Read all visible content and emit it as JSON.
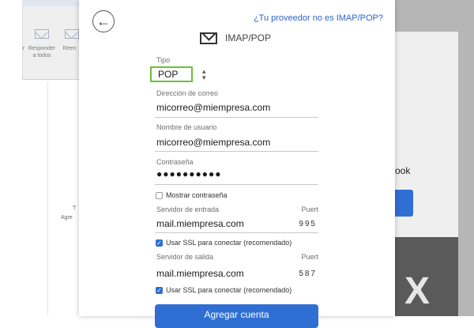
{
  "background_app": {
    "reply_all_label": "Responder\na todos",
    "forward_label": "Reen",
    "left_label": "r",
    "side_text_1": "T",
    "side_text_2": "Agre",
    "right_text": "ook",
    "colors": {
      "accent": "#2f6fd4"
    }
  },
  "dialog": {
    "provider_link": "¿Tu proveedor no es IMAP/POP?",
    "title": "IMAP/POP",
    "type_label": "Tipo",
    "type_value": "POP",
    "email_label": "Dirección de correo",
    "email_value": "micorreo@miempresa.com",
    "username_label": "Nombre de usuario",
    "username_value": "micorreo@miempresa.com",
    "password_label": "Contraseña",
    "password_value": "●●●●●●●●●●",
    "show_password_label": "Mostrar contraseña",
    "show_password_checked": false,
    "incoming_server_label": "Servidor de entrada",
    "incoming_port_label": "Puert",
    "incoming_server_value": "mail.miempresa.com",
    "incoming_port_value": "995",
    "incoming_ssl_label": "Usar SSL para conectar (recomendado)",
    "incoming_ssl_checked": true,
    "outgoing_server_label": "Servidor de salida",
    "outgoing_port_label": "Puert",
    "outgoing_server_value": "mail.miempresa.com",
    "outgoing_port_value": "587",
    "outgoing_ssl_label": "Usar SSL para conectar (recomendado)",
    "outgoing_ssl_checked": true,
    "add_account_button": "Agregar cuenta"
  },
  "icons": {
    "back": "arrow-left-icon",
    "mail": "envelope-icon",
    "select": "chevron-up-down-icon",
    "check": "checkmark-icon"
  }
}
